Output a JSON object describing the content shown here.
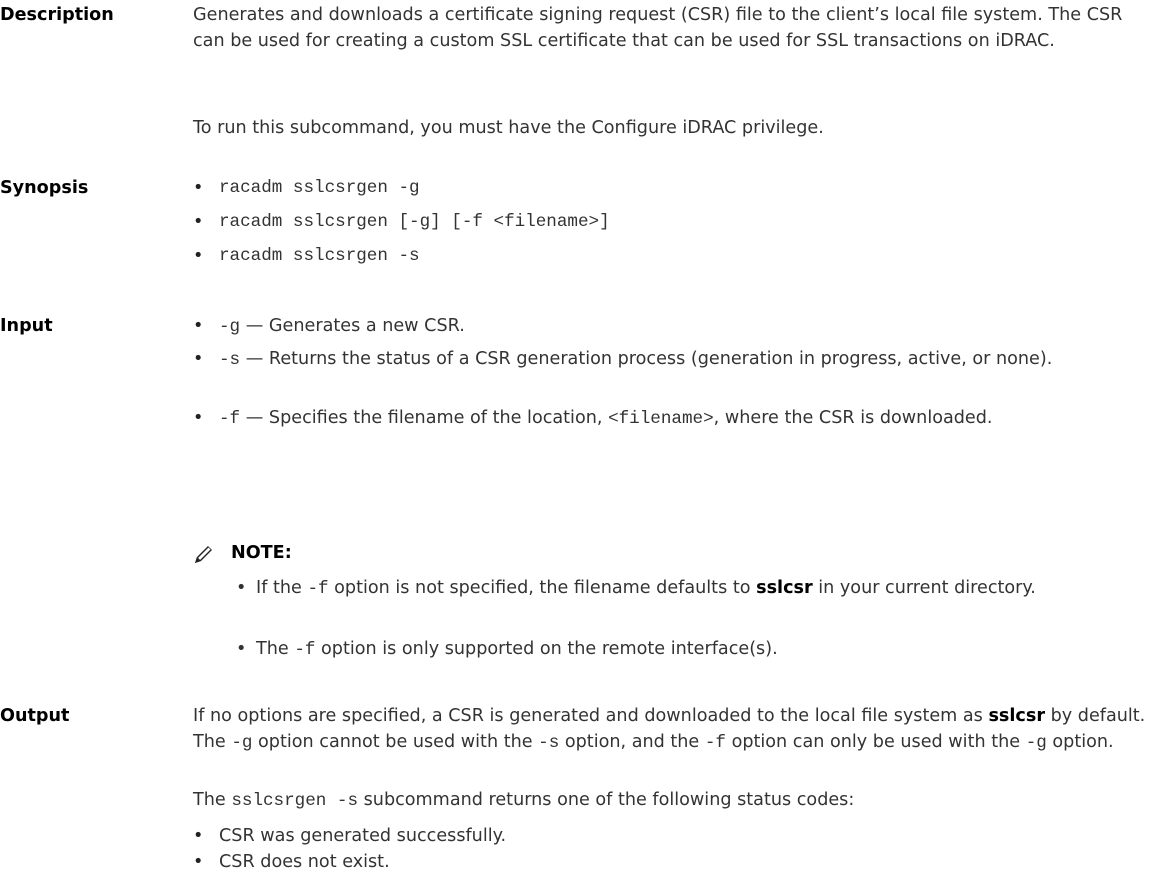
{
  "description": {
    "label": "Description",
    "para1": "Generates and downloads a certificate signing request (CSR) file to the client’s local file system. The CSR can be used for creating a custom SSL certificate that can be used for SSL transactions on iDRAC.",
    "para2": "To run this subcommand, you must have the Configure iDRAC privilege."
  },
  "synopsis": {
    "label": "Synopsis",
    "items": [
      "racadm sslcsrgen -g",
      "racadm sslcsrgen [-g] [-f <filename>]",
      "racadm sslcsrgen -s"
    ]
  },
  "input": {
    "label": "Input",
    "items": [
      {
        "flag": "-g",
        "text": " — Generates a new CSR."
      },
      {
        "flag": "-s",
        "text": " — Returns the status of a CSR generation process (generation in progress, active, or none)."
      },
      {
        "flag": "-f",
        "text_a": " — Specifies the filename of the location, ",
        "code": "<filename>",
        "text_b": ", where the CSR is downloaded."
      }
    ],
    "note": {
      "label": "NOTE:",
      "icon": "pencil-icon",
      "items": [
        {
          "a": "If the ",
          "code": "-f",
          "b": " option is not specified, the filename defaults to ",
          "bold": "sslcsr",
          "c": " in your current directory."
        },
        {
          "a": "The ",
          "code": "-f",
          "b": " option is only supported on the remote interface(s)."
        }
      ]
    }
  },
  "output": {
    "label": "Output",
    "p1_a": "If no options are specified, a CSR is generated and downloaded to the local file system as ",
    "p1_bold": "sslcsr",
    "p1_b": " by default. The ",
    "p1_code1": "-g",
    "p1_c": " option cannot be used with the ",
    "p1_code2": "-s",
    "p1_d": " option, and the ",
    "p1_code3": "-f",
    "p1_e": " option can only be used with the ",
    "p1_code4": "-g",
    "p1_f": " option.",
    "p2_a": "The ",
    "p2_code": "sslcsrgen -s",
    "p2_b": " subcommand returns one of the following status codes:",
    "items": [
      "CSR was generated successfully.",
      "CSR does not exist."
    ]
  }
}
